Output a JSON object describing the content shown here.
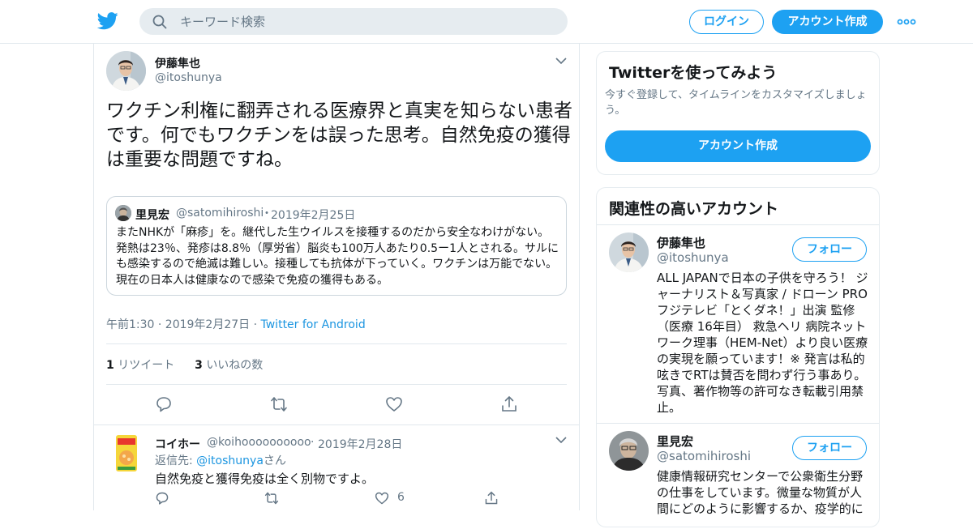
{
  "header": {
    "search_placeholder": "キーワード検索",
    "login_label": "ログイン",
    "signup_label": "アカウント作成"
  },
  "tweet": {
    "author_name": "伊藤隼也",
    "author_handle": "@itoshunya",
    "text": "ワクチン利権に翻弄される医療界と真実を知らない患者です。何でもワクチンをは誤った思考。自然免疫の獲得は重要な問題ですね。",
    "quoted": {
      "name": "里見宏",
      "handle": "@satomihiroshi",
      "separator": "・",
      "date": "2019年2月25日",
      "text": "またNHKが「麻疹」を。継代した生ウイルスを接種するのだから安全なわけがない。発熱は23％、発疹は8.8％（厚労省）脳炎も100万人あたり0.5ー1人とされる。サルにも感染するので絶滅は難しい。接種しても抗体が下っていく。ワクチンは万能でない。現在の日本人は健康なので感染で免疫の獲得もある。"
    },
    "timestamp": "午前1:30 · 2019年2月27日",
    "meta_separator": "·",
    "source": "Twitter for Android",
    "retweet_count": "1",
    "retweet_label": "リツイート",
    "like_count": "3",
    "like_label": "いいねの数"
  },
  "reply": {
    "author_name": "コイホー",
    "author_handle": "@koihoooooooooo",
    "separator": "·",
    "date": "2019年2月28日",
    "reply_to_prefix": "返信先: ",
    "reply_to_handle": "@itoshunya",
    "reply_to_suffix": "さん",
    "text": "自然免疫と獲得免疫は全く別物ですよ。",
    "like_count": "6"
  },
  "sidebar": {
    "signup_card": {
      "title": "Twitterを使ってみよう",
      "description": "今すぐ登録して、タイムラインをカスタマイズしましょう。",
      "button_label": "アカウント作成"
    },
    "related": {
      "title": "関連性の高いアカウント",
      "accounts": [
        {
          "name": "伊藤隼也",
          "handle": "@itoshunya",
          "follow_label": "フォロー",
          "bio": "ALL JAPANで日本の子供を守ろう！ ジャーナリスト＆写真家 / ドローン PRO フジテレビ「とくダネ！」出演 監修（医療 16年目） 救急ヘリ 病院ネットワーク理事（HEM-Net）より良い医療の実現を願っています！※ 発言は私的呟きでRTは賛否を問わず行う事あり。写真、著作物等の許可なき転載引用禁止。"
        },
        {
          "name": "里見宏",
          "handle": "@satomihiroshi",
          "follow_label": "フォロー",
          "bio": "健康情報研究センターで公衆衛生分野の仕事をしています。微量な物質が人間にどのように影響するか、疫学的に"
        }
      ]
    }
  },
  "colors": {
    "accent": "#1da1f2",
    "link": "#1b95e0",
    "muted": "#657786",
    "border": "#e1e8ed"
  }
}
